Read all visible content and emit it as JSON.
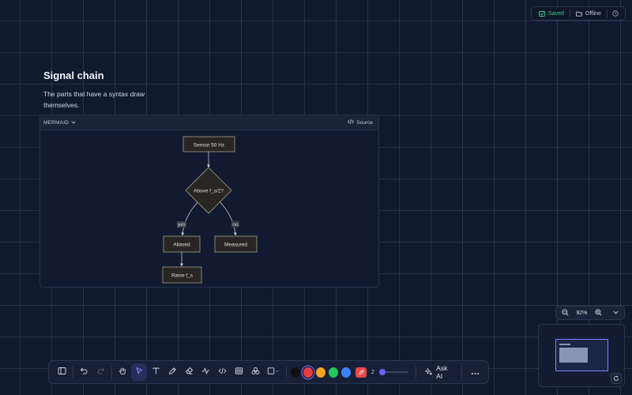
{
  "status": {
    "saved_label": "Saved",
    "offline_label": "Offline",
    "saved_color": "#3fcf8e"
  },
  "document": {
    "title": "Signal chain",
    "body": "The parts that have a syntax draw themselves."
  },
  "mermaid": {
    "language_label": "MERMAID",
    "source_label": "Source",
    "diagram": {
      "nodes": [
        {
          "id": "sensor",
          "label": "Sensor 50 Hz",
          "shape": "rect"
        },
        {
          "id": "check",
          "label": "Above f_s/2?",
          "shape": "diamond"
        },
        {
          "id": "aliased",
          "label": "Aliased",
          "shape": "rect"
        },
        {
          "id": "measured",
          "label": "Measured",
          "shape": "rect"
        },
        {
          "id": "raise",
          "label": "Raise f_s",
          "shape": "rect"
        }
      ],
      "edges": [
        {
          "from": "sensor",
          "to": "check",
          "label": ""
        },
        {
          "from": "check",
          "to": "aliased",
          "label": "yes"
        },
        {
          "from": "check",
          "to": "measured",
          "label": "no"
        },
        {
          "from": "aliased",
          "to": "raise",
          "label": ""
        }
      ]
    }
  },
  "zoom": {
    "level": "92%"
  },
  "toolbar": {
    "tools": [
      {
        "name": "sidebar-toggle",
        "icon": "panel-left-icon"
      },
      {
        "name": "undo",
        "icon": "undo-icon"
      },
      {
        "name": "redo",
        "icon": "redo-icon"
      },
      {
        "name": "hand",
        "icon": "hand-icon"
      },
      {
        "name": "select",
        "icon": "cursor-icon"
      },
      {
        "name": "text",
        "icon": "text-icon"
      },
      {
        "name": "pen",
        "icon": "pen-icon"
      },
      {
        "name": "eraser",
        "icon": "eraser-icon"
      },
      {
        "name": "connector",
        "icon": "connector-icon"
      },
      {
        "name": "code",
        "icon": "code-icon"
      },
      {
        "name": "table",
        "icon": "table-icon"
      },
      {
        "name": "shapes",
        "icon": "shapes-icon"
      },
      {
        "name": "frame",
        "icon": "square-icon"
      }
    ],
    "colors": [
      "#111111",
      "#e53e3e",
      "#f5a524",
      "#22c55e",
      "#3b82f6"
    ],
    "selected_color": "#e53e3e",
    "stroke_width": "2",
    "stroke_slider_fraction": 0.12,
    "ask_ai_label": "Ask AI"
  }
}
